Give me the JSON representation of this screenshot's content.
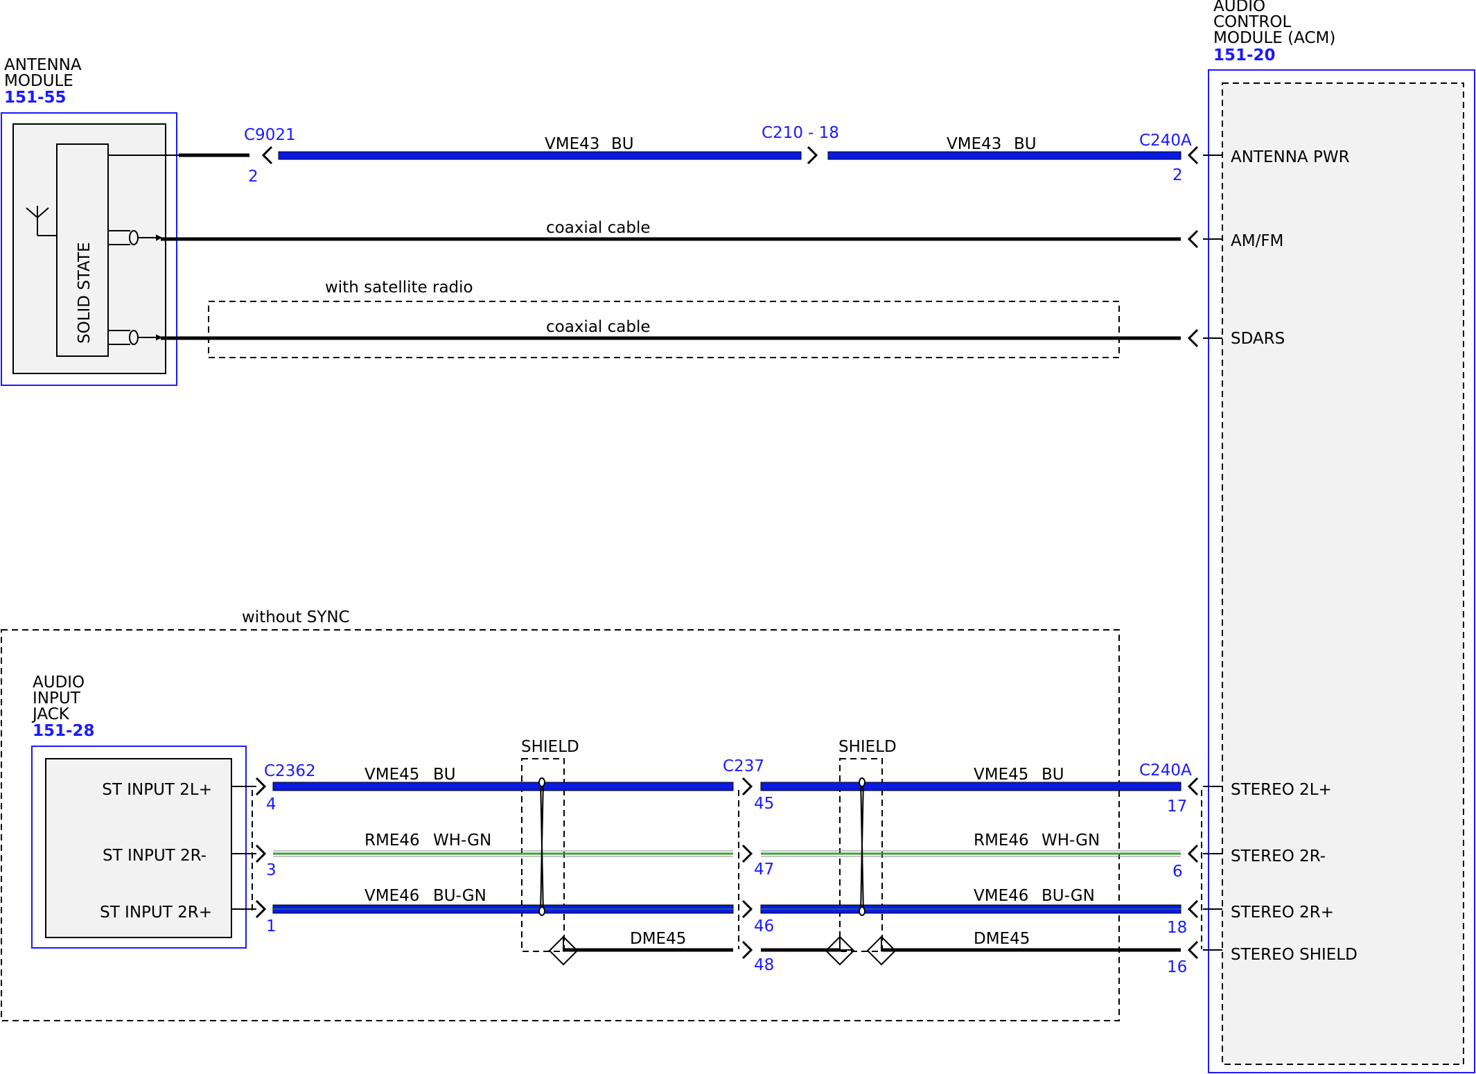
{
  "colors": {
    "blue": "#1a1aff",
    "wire_blue": "#0a1ae0",
    "green": "#3aa03a",
    "box_fill": "#f2f2f2"
  },
  "acm": {
    "line1": "AUDIO",
    "line2": "CONTROL",
    "line3": "MODULE (ACM)",
    "id": "151-20",
    "pins": {
      "antenna_pwr": "ANTENNA PWR",
      "amfm": "AM/FM",
      "sdars": "SDARS",
      "stereo_2l_plus": "STEREO 2L+",
      "stereo_2r_minus": "STEREO 2R-",
      "stereo_2r_plus": "STEREO 2R+",
      "stereo_shield": "STEREO SHIELD"
    }
  },
  "antenna_module": {
    "line1": "ANTENNA",
    "line2": "MODULE",
    "id": "151-55",
    "inner_label": "SOLID STATE"
  },
  "audio_input_jack": {
    "line1": "AUDIO",
    "line2": "INPUT",
    "line3": "JACK",
    "id": "151-28",
    "pins": {
      "st_input_2l_plus": "ST INPUT 2L+",
      "st_input_2r_minus": "ST INPUT 2R-",
      "st_input_2r_plus": "ST INPUT 2R+"
    }
  },
  "connectors": {
    "c9021": "C9021",
    "c9021_pin": "2",
    "c210": "C210",
    "c210_pin": "- 18",
    "c240a_top": "C240A",
    "c240a_top_pin": "2",
    "c2362": "C2362",
    "c2362_pins": [
      "4",
      "3",
      "1"
    ],
    "c237": "C237",
    "c237_pins": [
      "45",
      "47",
      "46",
      "48"
    ],
    "c240a_bottom": "C240A",
    "c240a_bottom_pins": [
      "17",
      "6",
      "18",
      "16"
    ]
  },
  "wires": {
    "vme43": "VME43",
    "vme43_color": "BU",
    "coax": "coaxial cable",
    "vme45": "VME45",
    "vme45_color": "BU",
    "rme46": "RME46",
    "rme46_color": "WH-GN",
    "vme46": "VME46",
    "vme46_color": "BU-GN",
    "dme45": "DME45"
  },
  "options": {
    "satellite": "with satellite radio",
    "without_sync": "without SYNC",
    "shield": "SHIELD"
  }
}
